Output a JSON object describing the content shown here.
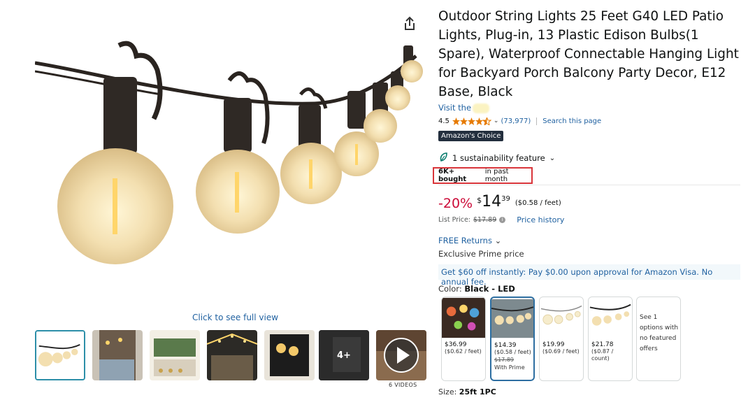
{
  "product": {
    "title": "Outdoor String Lights 25 Feet G40 LED Patio Lights, Plug-in, 13 Plastic Edison Bulbs(1 Spare), Waterproof Connectable Hanging Light for Backyard Porch Balcony Party Decor, E12 Base, Black",
    "visit_store": "Visit the",
    "rating_value": "4.5",
    "rating_count": "(73,977)",
    "search_page": "Search this page",
    "badge": "Amazon's Choice",
    "sustainability": "1 sustainability feature",
    "bought_bold": "6K+ bought",
    "bought_rest": "in past month"
  },
  "pricing": {
    "discount": "-20%",
    "currency": "$",
    "whole": "14",
    "fraction": "39",
    "unit_price": "($0.58 / feet)",
    "list_price_label": "List Price:",
    "list_price": "$17.89",
    "price_history": "Price history",
    "free_returns": "FREE Returns",
    "prime_price": "Exclusive Prime price",
    "visa_offer": "Get $60 off instantly: Pay $0.00 upon approval for Amazon Visa. No annual fee."
  },
  "gallery": {
    "full_view": "Click to see full view",
    "more_count": "4+",
    "videos_label": "6 VIDEOS",
    "selected_index": 0
  },
  "variants": {
    "color_label": "Color:",
    "color_value": "Black - LED",
    "swatches": [
      {
        "price": "$36.99",
        "unit": "($0.62 / feet)",
        "old": "",
        "note": ""
      },
      {
        "price": "$14.39",
        "unit": "($0.58 / feet)",
        "old": "$17.89",
        "note": "With Prime"
      },
      {
        "price": "$19.99",
        "unit": "($0.69 / feet)",
        "old": "",
        "note": ""
      },
      {
        "price": "$21.78",
        "unit": "($0.87 / count)",
        "old": "",
        "note": ""
      }
    ],
    "more_options": "See 1 options with no featured offers",
    "size_label": "Size:",
    "size_value": "25ft 1PC"
  },
  "colors": {
    "link": "#2162a1",
    "discount": "#cc0c39",
    "highlight_box": "#d9353a",
    "badge_bg": "#232f3e",
    "selected_border": "#2d6ea1"
  },
  "icons": [
    "share-icon",
    "star-icon",
    "chevron-down-icon",
    "leaf-icon",
    "info-icon",
    "play-icon"
  ]
}
